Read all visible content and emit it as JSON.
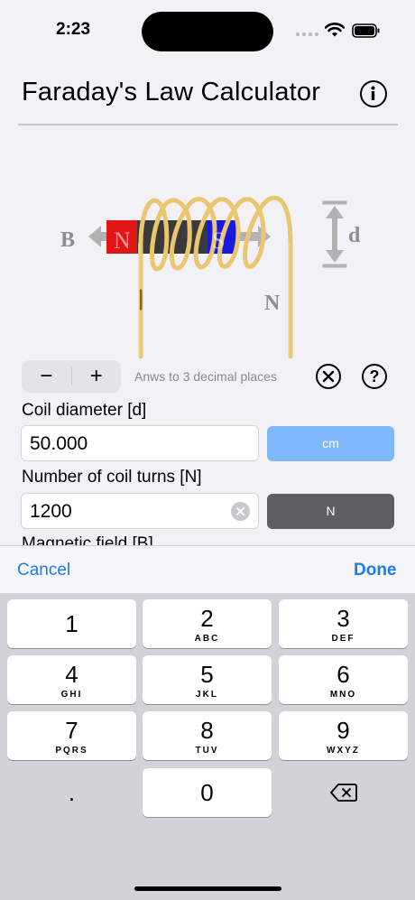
{
  "status_bar": {
    "time": "2:23"
  },
  "header": {
    "title": "Faraday's Law Calculator",
    "info_icon": "info-icon"
  },
  "illustration": {
    "label_b": "B",
    "label_n_pole": "N",
    "label_s_pole": "S",
    "label_d": "d",
    "label_n_turns": "N",
    "colors": {
      "north": "#e01717",
      "south": "#1a1adf",
      "middle": "#3a3a3a",
      "coil": "#e9c66f",
      "arrow": "#b2b2b2"
    }
  },
  "controls": {
    "minus_label": "−",
    "plus_label": "+",
    "precision_note": "Anws to 3 decimal places",
    "clear_icon": "clear-all-icon",
    "help_label": "?"
  },
  "fields": {
    "coil_diameter": {
      "label": "Coil diameter [d]",
      "value": "50.000",
      "unit": "cm"
    },
    "coil_turns": {
      "label": "Number of coil turns [N]",
      "value": "1200",
      "unit": "N"
    },
    "magnetic_field": {
      "label": "Magnetic field [B]"
    }
  },
  "accessory": {
    "cancel": "Cancel",
    "done": "Done"
  },
  "keyboard": {
    "keys": [
      {
        "num": "1",
        "letters": ""
      },
      {
        "num": "2",
        "letters": "ABC"
      },
      {
        "num": "3",
        "letters": "DEF"
      },
      {
        "num": "4",
        "letters": "GHI"
      },
      {
        "num": "5",
        "letters": "JKL"
      },
      {
        "num": "6",
        "letters": "MNO"
      },
      {
        "num": "7",
        "letters": "PQRS"
      },
      {
        "num": "8",
        "letters": "TUV"
      },
      {
        "num": "9",
        "letters": "WXYZ"
      },
      {
        "num": "0",
        "letters": ""
      }
    ],
    "decimal": ".",
    "delete_icon": "backspace-icon"
  },
  "colors": {
    "accent": "#1a7cf2",
    "unit_active": "#7fb8fb",
    "unit_inactive": "#5e5e60"
  }
}
